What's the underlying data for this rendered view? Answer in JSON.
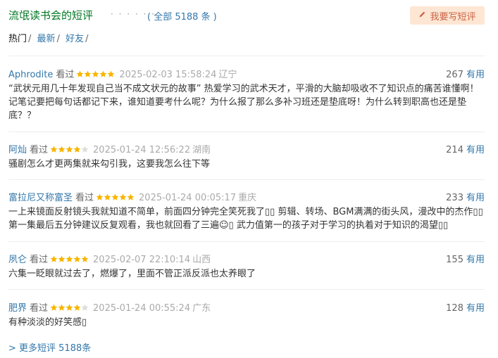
{
  "header": {
    "title": "流氓读书会的短评",
    "dots": "· · · · · ·",
    "total": "( 全部 5188 条 )",
    "write_button": "我要写短评"
  },
  "tabs": [
    {
      "label": "热门",
      "active": true
    },
    {
      "label": "最新",
      "active": false
    },
    {
      "label": "好友",
      "active": false
    }
  ],
  "tab_separator": "/",
  "comments": [
    {
      "author": "Aphrodite",
      "status": "看过",
      "rating": 5,
      "time": "2025-02-03 15:58:24",
      "location": "辽宁",
      "votes": "267",
      "useful": "有用",
      "content": "“武状元用几十年发现自己当不成文状元的故事” 热爱学习的武术天才，平滑的大脑却吸收不了知识点的痛苦谁懂啊！记笔记要把每句话都记下来，谁知道要考什么呢？为什么报了那么多补习班还是垫底呀！为什么转到职高也还是垫底？？"
    },
    {
      "author": "阿灿",
      "status": "看过",
      "rating": 4,
      "time": "2025-01-24 12:56:22",
      "location": "湖南",
      "votes": "214",
      "useful": "有用",
      "content": "骚剧怎么才更两集就来勾引我，这要我怎么往下等"
    },
    {
      "author": "富拉尼又称富圣",
      "status": "看过",
      "rating": 5,
      "time": "2025-01-24 00:05:17",
      "location": "重庆",
      "votes": "233",
      "useful": "有用",
      "content": "一上来镜面反射镜头我就知道不简单，前面四分钟完全笑死我了▯▯ 剪辑、转场、BGM满满的街头风，漫改中的杰作▯▯ 第一集最后五分钟建议反复观看，我也就回看了三遍☺▯ 武力值第一的孩子对于学习的执着对于知识的渴望▯▯"
    },
    {
      "author": "夙仑",
      "status": "看过",
      "rating": 5,
      "time": "2025-02-07 22:10:14",
      "location": "山西",
      "votes": "155",
      "useful": "有用",
      "content": "六集一眨眼就过去了，燃爆了，里面不管正派反派也太养眼了"
    },
    {
      "author": "肥界",
      "status": "看过",
      "rating": 4,
      "time": "2025-01-24 00:55:24",
      "location": "广东",
      "votes": "128",
      "useful": "有用",
      "content": "有种淡淡的好笑感▯"
    }
  ],
  "more_link": "> 更多短评 5188条",
  "colors": {
    "star": "#f7b500",
    "star_empty": "#ddd",
    "link": "#37a",
    "title": "#007722"
  },
  "icons": {
    "write": "pencil-icon",
    "star": "star-icon"
  }
}
